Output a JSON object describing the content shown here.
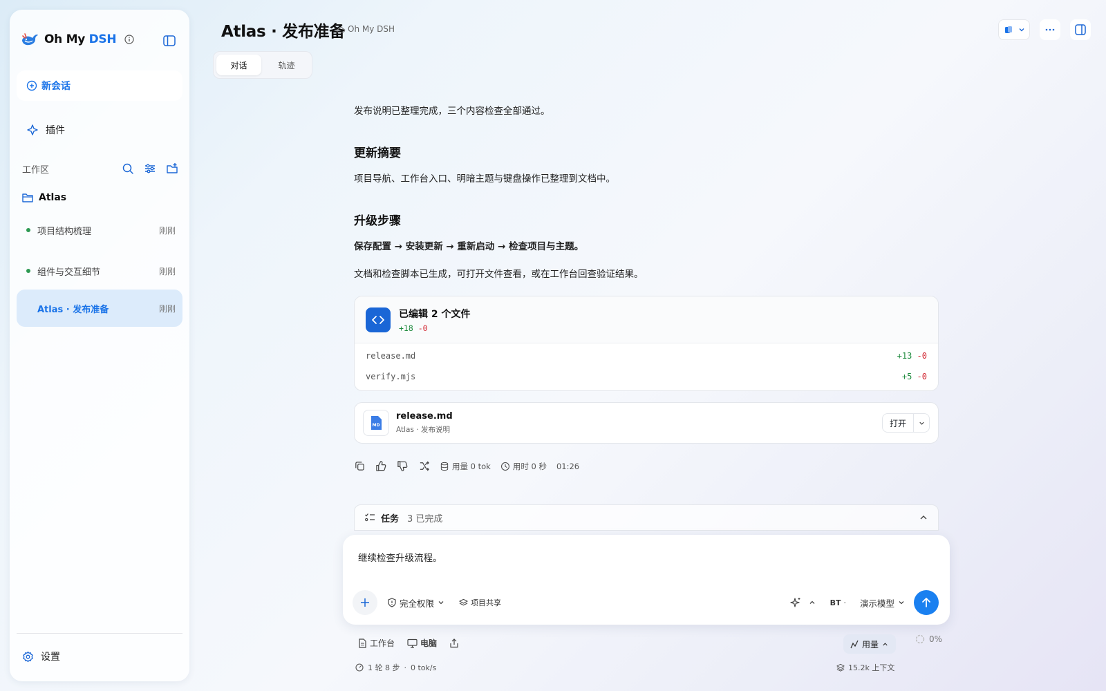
{
  "sidebar": {
    "brand": {
      "prefix": "Oh My ",
      "accent": "DSH"
    },
    "new_chat": "新会话",
    "plugins": "插件",
    "workspace_label": "工作区",
    "folder": "Atlas",
    "sessions": [
      {
        "title": "项目结构梳理",
        "time": "刚刚"
      },
      {
        "title": "组件与交互细节",
        "time": "刚刚"
      },
      {
        "title": "Atlas · 发布准备",
        "time": "刚刚"
      }
    ],
    "settings": "设置"
  },
  "header": {
    "title": "Atlas · 发布准备",
    "project": "Oh My DSH"
  },
  "tabs": [
    {
      "label": "对话"
    },
    {
      "label": "轨迹"
    }
  ],
  "message": {
    "intro": "发布说明已整理完成，三个内容检查全部通过。",
    "h_summary": "更新摘要",
    "summary": "项目导航、工作台入口、明暗主题与键盘操作已整理到文档中。",
    "h_steps": "升级步骤",
    "steps": "保存配置 → 安装更新 → 重新启动 → 检查项目与主题。",
    "note": "文档和检查脚本已生成，可打开文件查看，或在工作台回查验证结果。"
  },
  "edits": {
    "title": "已编辑 2 个文件",
    "total_add": "+18",
    "total_del": "-0",
    "files": [
      {
        "name": "release.md",
        "add": "+13",
        "del": "-0"
      },
      {
        "name": "verify.mjs",
        "add": "+5",
        "del": "-0"
      }
    ]
  },
  "file_card": {
    "name": "release.md",
    "subtitle": "Atlas · 发布说明",
    "open": "打开"
  },
  "meta": {
    "usage": "用量 0 tok",
    "duration": "用时 0 秒",
    "time": "01:26"
  },
  "tasks": {
    "label": "任务",
    "count": "3 已完成"
  },
  "composer": {
    "text": "继续检查升级流程。",
    "permission": "完全权限",
    "share": "项目共享",
    "bt": "BT",
    "model": "演示模型"
  },
  "footer": {
    "workbench": "工作台",
    "computer": "电脑",
    "usage": "用量",
    "percent": "0%",
    "steps": "1 轮 8 步",
    "speed": "0 tok/s",
    "context": "15.2k 上下文"
  },
  "colors": {
    "accent": "#1a73e8",
    "add": "#1e8a3d",
    "del": "#d1242f",
    "active_bg": "#dcebfb"
  }
}
